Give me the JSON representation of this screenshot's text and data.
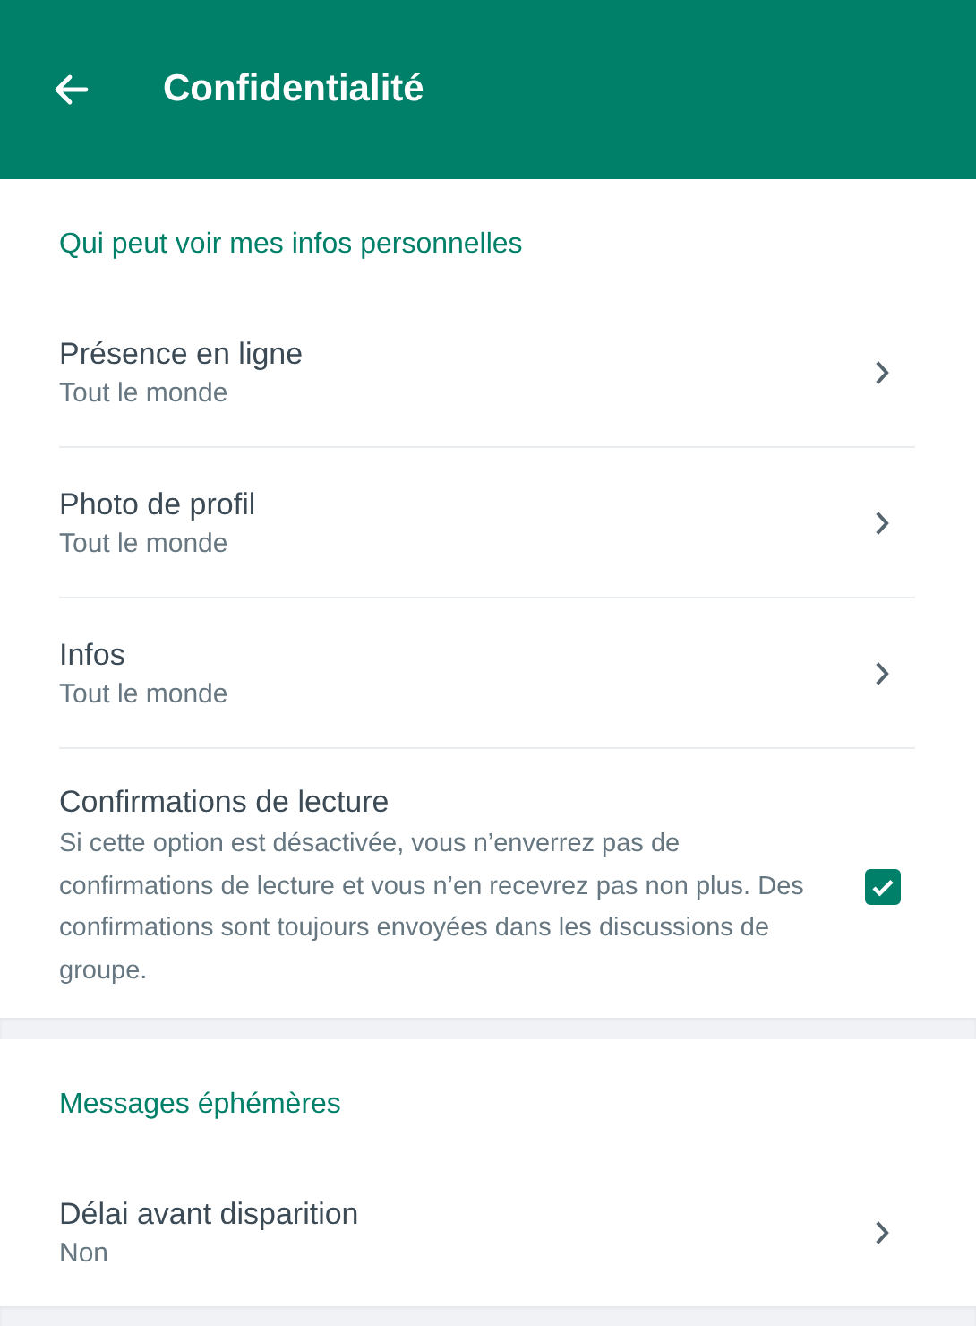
{
  "header": {
    "title": "Confidentialité"
  },
  "sections": [
    {
      "title": "Qui peut voir mes infos personnelles",
      "items": [
        {
          "kind": "link",
          "label": "Présence en ligne",
          "value": "Tout le monde"
        },
        {
          "kind": "link",
          "label": "Photo de profil",
          "value": "Tout le monde"
        },
        {
          "kind": "link",
          "label": "Infos",
          "value": "Tout le monde"
        },
        {
          "kind": "checkbox",
          "label": "Confirmations de lecture",
          "description": "Si cette option est désactivée, vous n’enverrez pas de confirmations de lecture et vous n’en recevrez pas non plus. Des confirmations sont toujours envoyées dans les discussions de groupe.",
          "checked": true
        }
      ]
    },
    {
      "title": "Messages éphémères",
      "items": [
        {
          "kind": "link",
          "label": "Délai avant disparition",
          "value": "Non"
        }
      ]
    }
  ]
}
